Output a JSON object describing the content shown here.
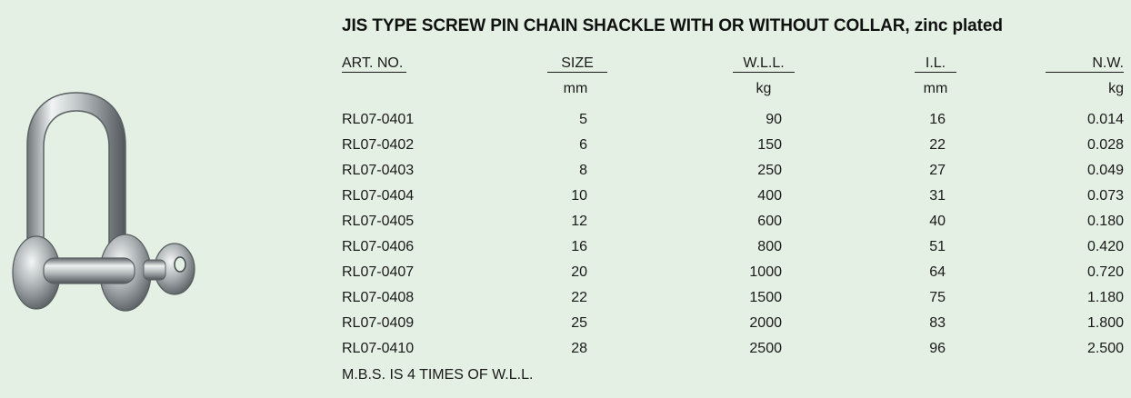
{
  "title": "JIS TYPE SCREW PIN CHAIN SHACKLE WITH OR WITHOUT COLLAR, zinc plated",
  "table": {
    "headers": {
      "art_no": "ART. NO.",
      "size": "SIZE",
      "wll": "W.L.L.",
      "il": "I.L.",
      "nw": "N.W."
    },
    "units": {
      "art_no": "",
      "size": "mm",
      "wll": "kg",
      "il": "mm",
      "nw": "kg"
    },
    "rows": [
      {
        "art_no": "RL07-0401",
        "size": "5",
        "wll": "90",
        "il": "16",
        "nw": "0.014"
      },
      {
        "art_no": "RL07-0402",
        "size": "6",
        "wll": "150",
        "il": "22",
        "nw": "0.028"
      },
      {
        "art_no": "RL07-0403",
        "size": "8",
        "wll": "250",
        "il": "27",
        "nw": "0.049"
      },
      {
        "art_no": "RL07-0404",
        "size": "10",
        "wll": "400",
        "il": "31",
        "nw": "0.073"
      },
      {
        "art_no": "RL07-0405",
        "size": "12",
        "wll": "600",
        "il": "40",
        "nw": "0.180"
      },
      {
        "art_no": "RL07-0406",
        "size": "16",
        "wll": "800",
        "il": "51",
        "nw": "0.420"
      },
      {
        "art_no": "RL07-0407",
        "size": "20",
        "wll": "1000",
        "il": "64",
        "nw": "0.720"
      },
      {
        "art_no": "RL07-0408",
        "size": "22",
        "wll": "1500",
        "il": "75",
        "nw": "1.180"
      },
      {
        "art_no": "RL07-0409",
        "size": "25",
        "wll": "2000",
        "il": "83",
        "nw": "1.800"
      },
      {
        "art_no": "RL07-0410",
        "size": "28",
        "wll": "2500",
        "il": "96",
        "nw": "2.500"
      }
    ]
  },
  "footnote": "M.B.S. IS 4 TIMES OF W.L.L.",
  "image": {
    "icon": "d-shackle-icon"
  },
  "colors": {
    "background": "#e3f0e3",
    "text": "#1a1a1a"
  }
}
